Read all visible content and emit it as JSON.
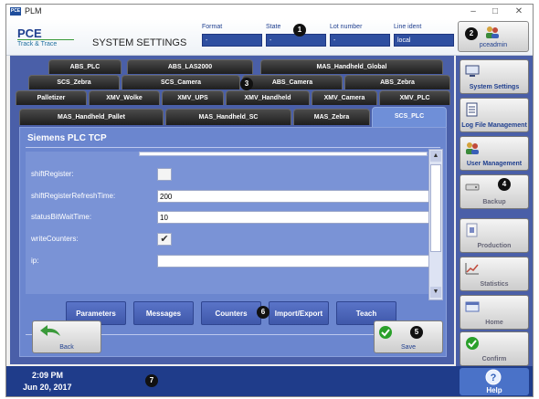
{
  "window": {
    "app_icon": "PCE",
    "title": "PLM",
    "controls": [
      "–",
      "□",
      "✕"
    ]
  },
  "header": {
    "logo": "PCE",
    "logo_sub": "Track & Trace",
    "page_title": "SYSTEM SETTINGS",
    "fields": [
      {
        "label": "Format",
        "value": "-"
      },
      {
        "label": "State",
        "value": "-"
      },
      {
        "label": "Lot number",
        "value": "-"
      },
      {
        "label": "Line ident",
        "value": "local"
      }
    ],
    "user": "pceadmin"
  },
  "tabs": {
    "row1": [
      "ABS_PLC",
      "ABS_LAS2000",
      "MAS_Handheld_Global"
    ],
    "row2": [
      "SCS_Zebra",
      "SCS_Camera",
      "ABS_Camera",
      "ABS_Zebra"
    ],
    "row3": [
      "Palletizer",
      "XMV_Wolke",
      "XMV_UPS",
      "XMV_Handheld",
      "XMV_Camera",
      "XMV_PLC"
    ],
    "row4": [
      "MAS_Handheld_Pallet",
      "MAS_Handheld_SC",
      "MAS_Zebra",
      "SCS_PLC"
    ],
    "active": "SCS_PLC"
  },
  "content": {
    "title": "Siemens PLC TCP",
    "fields": [
      {
        "label": "shiftRegister:",
        "type": "checkbox",
        "checked": false
      },
      {
        "label": "shiftRegisterRefreshTime:",
        "type": "text",
        "value": "200"
      },
      {
        "label": "statusBitWaitTime:",
        "type": "text",
        "value": "10"
      },
      {
        "label": "writeCounters:",
        "type": "checkbox",
        "checked": true
      },
      {
        "label": "ip:",
        "type": "text",
        "value": ""
      }
    ],
    "sub_buttons": [
      "Parameters",
      "Messages",
      "Counters",
      "Import/Export",
      "Teach"
    ],
    "back_label": "Back",
    "save_label": "Save"
  },
  "nav": [
    {
      "label": "System Settings",
      "icon": "computer-icon"
    },
    {
      "label": "Log File Management",
      "icon": "log-file-icon"
    },
    {
      "label": "User Management",
      "icon": "users-icon"
    },
    {
      "label": "Backup",
      "icon": "backup-drive-icon"
    },
    {
      "label": "Production",
      "icon": "production-icon"
    },
    {
      "label": "Statistics",
      "icon": "statistics-icon"
    },
    {
      "label": "Home",
      "icon": "home-icon"
    },
    {
      "label": "Confirm",
      "icon": "confirm-icon"
    }
  ],
  "status": {
    "time": "2:09 PM",
    "date": "Jun 20, 2017",
    "help_label": "Help"
  },
  "markers": {
    "m1": "1",
    "m2": "2",
    "m3": "3",
    "m4": "4",
    "m5": "5",
    "m6": "6",
    "m7": "7"
  },
  "colors": {
    "panel_blue": "#4a5fa8",
    "active_tab": "#6f8fd8",
    "status_bar": "#1f3c8a",
    "confirm_green": "#2aa02a"
  }
}
